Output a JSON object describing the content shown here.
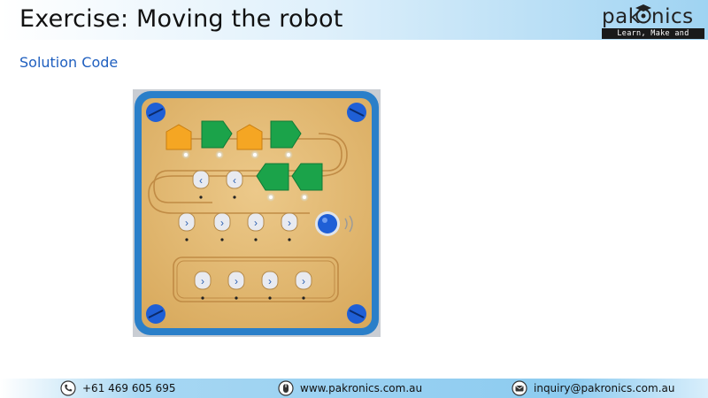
{
  "header": {
    "title": "Exercise: Moving the robot",
    "logo": {
      "word": "pakronics",
      "tagline": "Learn, Make and Invent"
    }
  },
  "main": {
    "subtitle": "Solution Code",
    "photo": {
      "icon": "cubetto-board-photo"
    }
  },
  "footer": {
    "phone": "+61 469 605 695",
    "website": "www.pakronics.com.au",
    "email": "inquiry@pakronics.com.au"
  },
  "colors": {
    "title_text": "#111111",
    "subtitle_text": "#1f5fbf",
    "header_gradient_end": "#9fd3f2",
    "footer_band": "#8ccbf0",
    "board_frame": "#2a7fc9",
    "board_wood": "#e2ba72",
    "block_orange": "#f5a623",
    "block_green": "#1ba34a",
    "button_blue": "#1f5fd6"
  }
}
